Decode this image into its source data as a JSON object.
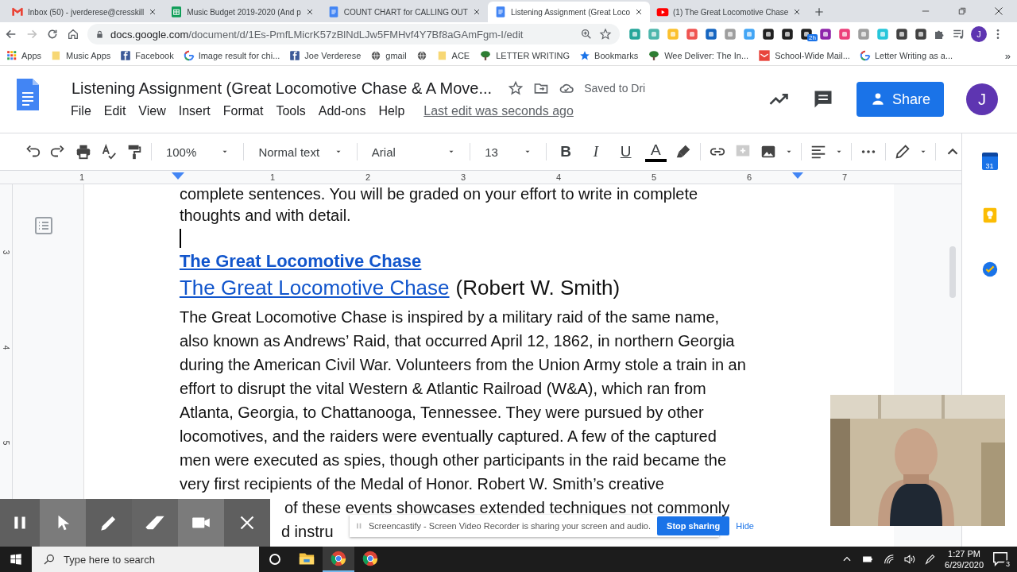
{
  "browser": {
    "tabs": [
      {
        "kind": "gmail",
        "title": "Inbox (50) - jverderese@cresskill",
        "selected": false
      },
      {
        "kind": "sheets",
        "title": "Music Budget 2019-2020 (And p",
        "selected": false
      },
      {
        "kind": "docs",
        "title": "COUNT CHART for CALLING OUT",
        "selected": false
      },
      {
        "kind": "docs",
        "title": "Listening Assignment (Great Loco",
        "selected": true
      },
      {
        "kind": "youtube",
        "title": "(1) The Great Locomotive Chase",
        "selected": false
      }
    ],
    "url_host": "docs.google.com",
    "url_path": "/document/d/1Es-PmfLMicrK57zBlNdLJw5FMHvf4Y7Bf8aGAmFgm-I/edit",
    "extension_badge": "2h",
    "profile_initial": "J",
    "bookmarks": [
      {
        "kind": "apps",
        "label": "Apps"
      },
      {
        "kind": "folder",
        "label": "Music Apps"
      },
      {
        "kind": "facebook",
        "label": "Facebook"
      },
      {
        "kind": "google",
        "label": "Image result for chi..."
      },
      {
        "kind": "facebook",
        "label": "Joe Verderese"
      },
      {
        "kind": "globe",
        "label": "gmail"
      },
      {
        "kind": "globe"
      },
      {
        "kind": "folder",
        "label": "ACE"
      },
      {
        "kind": "tree",
        "label": "LETTER WRITING"
      },
      {
        "kind": "star",
        "label": "Bookmarks"
      },
      {
        "kind": "tree",
        "label": "Wee Deliver: The In..."
      },
      {
        "kind": "mail",
        "label": "School-Wide Mail..."
      },
      {
        "kind": "google",
        "label": "Letter Writing as a..."
      }
    ],
    "bookmarks_more": "»"
  },
  "docs": {
    "title": "Listening Assignment (Great Locomotive Chase & A Move...",
    "save_status": "Saved to Dri",
    "menu": [
      "File",
      "Edit",
      "View",
      "Insert",
      "Format",
      "Tools",
      "Add-ons",
      "Help"
    ],
    "last_edit": "Last edit was seconds ago",
    "share_label": "Share",
    "avatar_initial": "J"
  },
  "toolbar": {
    "zoom": "100%",
    "style": "Normal text",
    "font": "Arial",
    "size": "13",
    "format_buttons": [
      {
        "kind": "bold",
        "label": "B"
      },
      {
        "kind": "italic",
        "label": "I"
      },
      {
        "kind": "underline",
        "label": "U"
      },
      {
        "kind": "color",
        "label": "A"
      }
    ]
  },
  "ruler": [
    "1",
    "1",
    "2",
    "3",
    "4",
    "5",
    "6",
    "7"
  ],
  "vertical_ruler": [
    "3",
    "4",
    "5"
  ],
  "document": {
    "lines_top": [
      "complete sentences.  You will be graded on your effort to write in complete",
      "thoughts and with detail."
    ],
    "heading": "The Great Locomotive Chase",
    "link": "The Great Locomotive Chase",
    "link_suffix": "(Robert W. Smith)",
    "paragraph_lines": [
      "The Great Locomotive Chase is inspired by a military raid of the same name,",
      "also known as Andrews’ Raid, that occurred April 12, 1862, in northern Georgia",
      "during the American Civil War. Volunteers from the Union Army stole a train in an",
      "effort to disrupt the vital Western & Atlantic Railroad (W&A), which ran from",
      "Atlanta, Georgia, to Chattanooga, Tennessee. They were pursued by other",
      "locomotives, and the raiders were eventually captured. A few of the captured",
      "men were executed as spies, though other participants in the raid became the",
      "very first recipients of the Medal of Honor. Robert W. Smith’s creative"
    ],
    "covered_lines": [
      "of these events showcases extended techniques not commonly",
      "d instru"
    ]
  },
  "side_panel": {
    "calendar_day": "31"
  },
  "screencastify": {
    "message": "Screencastify - Screen Video Recorder is sharing your screen and audio.",
    "stop_label": "Stop sharing",
    "hide_label": "Hide"
  },
  "taskbar": {
    "search_placeholder": "Type here to search",
    "apps": [
      {
        "kind": "explorer",
        "selected": false
      },
      {
        "kind": "chrome",
        "selected": true
      },
      {
        "kind": "chrome",
        "selected": false
      }
    ],
    "time": "1:27 PM",
    "date": "6/29/2020",
    "notifications": "3"
  }
}
